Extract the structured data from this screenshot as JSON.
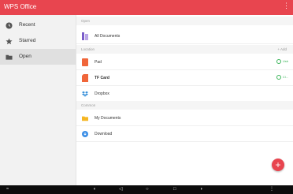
{
  "app": {
    "title": "WPS Office",
    "more_icon": "more-vert-icon",
    "accent": "#e8454f"
  },
  "sidebar": {
    "items": [
      {
        "label": "Recent",
        "icon": "clock-icon"
      },
      {
        "label": "Starred",
        "icon": "star-icon"
      },
      {
        "label": "Open",
        "icon": "folder-icon",
        "active": true
      }
    ]
  },
  "main": {
    "open_header": "Open",
    "all_documents": "All Documents",
    "location_header": "Location",
    "add_label": "+ Add",
    "locations": [
      {
        "label": "Pad",
        "status": "Usb"
      },
      {
        "label": "TF Card",
        "status": "Cl..."
      },
      {
        "label": "Dropbox"
      }
    ],
    "common_header": "Common",
    "common": [
      {
        "label": "My Documents"
      },
      {
        "label": "Download"
      }
    ]
  },
  "fab": {
    "label": "+"
  },
  "navbar": {
    "icons": [
      "wifi-icon",
      "volume-down-icon",
      "back-icon",
      "home-icon",
      "recents-icon",
      "volume-up-icon",
      "menu-icon"
    ]
  }
}
